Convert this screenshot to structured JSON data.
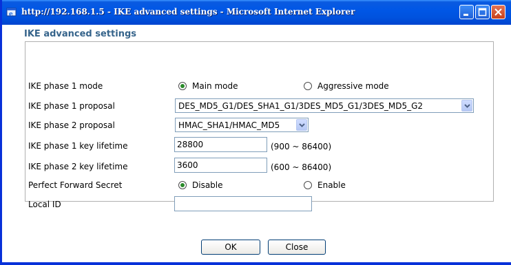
{
  "window": {
    "title": "http://192.168.1.5 - IKE advanced settings - Microsoft Internet Explorer"
  },
  "section_title": "IKE advanced settings",
  "rows": {
    "phase1_mode": {
      "label": "IKE phase 1 mode",
      "options": [
        "Main mode",
        "Aggressive mode"
      ],
      "selected": "Main mode"
    },
    "phase1_proposal": {
      "label": "IKE phase 1 proposal",
      "value": "DES_MD5_G1/DES_SHA1_G1/3DES_MD5_G1/3DES_MD5_G2"
    },
    "phase2_proposal": {
      "label": "IKE phase 2 proposal",
      "value": "HMAC_SHA1/HMAC_MD5"
    },
    "phase1_lifetime": {
      "label": "IKE phase 1 key lifetime",
      "value": "28800",
      "range": "(900 ~ 86400)"
    },
    "phase2_lifetime": {
      "label": "IKE phase 2 key lifetime",
      "value": "3600",
      "range": "(600 ~ 86400)"
    },
    "pfs": {
      "label": "Perfect Forward Secret",
      "options": [
        "Disable",
        "Enable"
      ],
      "selected": "Disable"
    },
    "local_id": {
      "label": "Local ID",
      "value": ""
    }
  },
  "buttons": {
    "ok": "OK",
    "close": "Close"
  },
  "colors": {
    "titlebar": "#0054e3",
    "section_title": "#36648b",
    "radio_selected": "#2a8a2a"
  }
}
